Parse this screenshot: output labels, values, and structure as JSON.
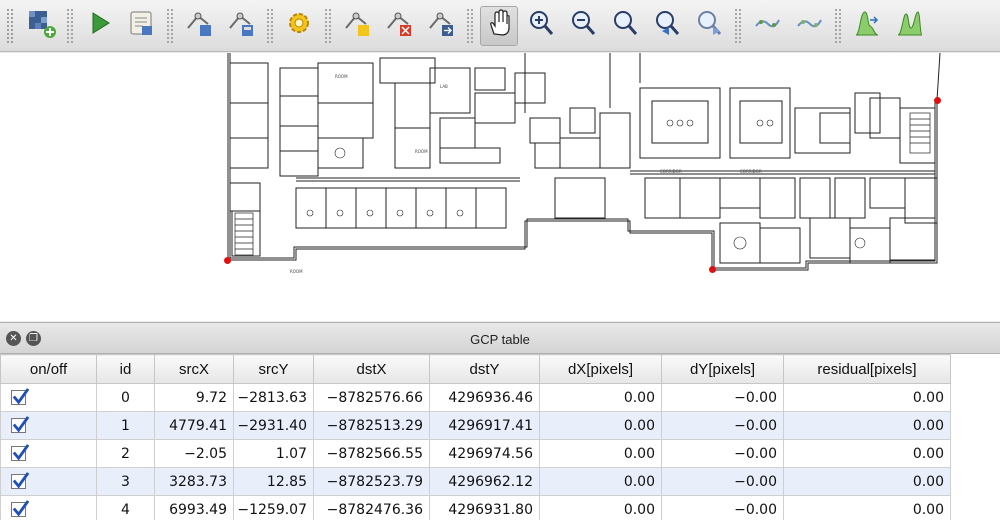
{
  "toolbar": {
    "items": [
      {
        "type": "button",
        "name": "open-raster-button",
        "icon": "open-raster-icon"
      },
      {
        "type": "sep"
      },
      {
        "type": "button",
        "name": "start-georeferencing-button",
        "icon": "play-icon"
      },
      {
        "type": "button",
        "name": "generate-gdal-script-button",
        "icon": "script-icon"
      },
      {
        "type": "sep"
      },
      {
        "type": "button",
        "name": "load-gcp-points-button",
        "icon": "load-gcp-icon"
      },
      {
        "type": "button",
        "name": "save-gcp-points-button",
        "icon": "save-gcp-icon"
      },
      {
        "type": "sep"
      },
      {
        "type": "button",
        "name": "transformation-settings-button",
        "icon": "gear-icon"
      },
      {
        "type": "sep"
      },
      {
        "type": "button",
        "name": "add-point-button",
        "icon": "add-point-icon"
      },
      {
        "type": "button",
        "name": "delete-point-button",
        "icon": "delete-point-icon"
      },
      {
        "type": "button",
        "name": "move-gcp-point-button",
        "icon": "move-point-icon"
      },
      {
        "type": "sep"
      },
      {
        "type": "button",
        "name": "pan-button",
        "icon": "hand-icon",
        "active": true
      },
      {
        "type": "button",
        "name": "zoom-in-button",
        "icon": "zoom-in-icon"
      },
      {
        "type": "button",
        "name": "zoom-out-button",
        "icon": "zoom-out-icon"
      },
      {
        "type": "button",
        "name": "zoom-to-layer-button",
        "icon": "zoom-layer-icon"
      },
      {
        "type": "button",
        "name": "zoom-last-button",
        "icon": "zoom-last-icon"
      },
      {
        "type": "button",
        "name": "zoom-next-button",
        "icon": "zoom-next-icon"
      },
      {
        "type": "sep"
      },
      {
        "type": "button",
        "name": "link-georeferencer-to-qgis-button",
        "icon": "link-geo-icon"
      },
      {
        "type": "button",
        "name": "link-qgis-to-georeferencer-button",
        "icon": "link-qgis-icon"
      },
      {
        "type": "sep"
      },
      {
        "type": "button",
        "name": "full-histogram-stretch-button",
        "icon": "histogram-full-icon"
      },
      {
        "type": "button",
        "name": "local-histogram-stretch-button",
        "icon": "histogram-local-icon"
      }
    ]
  },
  "panel": {
    "title": "GCP table",
    "close_icon": "close-icon",
    "float_icon": "float-icon"
  },
  "table": {
    "columns": [
      "on/off",
      "id",
      "srcX",
      "srcY",
      "dstX",
      "dstY",
      "dX[pixels]",
      "dY[pixels]",
      "residual[pixels]"
    ],
    "rows": [
      {
        "checked": true,
        "id": "0",
        "srcX": "9.72",
        "srcY": "-2813.63",
        "dstX": "-8782576.66",
        "dstY": "4296936.46",
        "dX": "0.00",
        "dY": "-0.00",
        "residual": "0.00"
      },
      {
        "checked": true,
        "id": "1",
        "srcX": "4779.41",
        "srcY": "-2931.40",
        "dstX": "-8782513.29",
        "dstY": "4296917.41",
        "dX": "0.00",
        "dY": "-0.00",
        "residual": "0.00"
      },
      {
        "checked": true,
        "id": "2",
        "srcX": "-2.05",
        "srcY": "1.07",
        "dstX": "-8782566.55",
        "dstY": "4296974.56",
        "dX": "0.00",
        "dY": "-0.00",
        "residual": "0.00"
      },
      {
        "checked": true,
        "id": "3",
        "srcX": "3283.73",
        "srcY": "12.85",
        "dstX": "-8782523.79",
        "dstY": "4296962.12",
        "dX": "0.00",
        "dY": "-0.00",
        "residual": "0.00"
      },
      {
        "checked": true,
        "id": "4",
        "srcX": "6993.49",
        "srcY": "-1259.07",
        "dstX": "-8782476.36",
        "dstY": "4296931.80",
        "dX": "0.00",
        "dY": "-0.00",
        "residual": "0.00"
      }
    ]
  },
  "colors": {
    "gcp_point": "#e01010",
    "row_alt": "#e8eefa",
    "check": "#1f4fb8"
  }
}
